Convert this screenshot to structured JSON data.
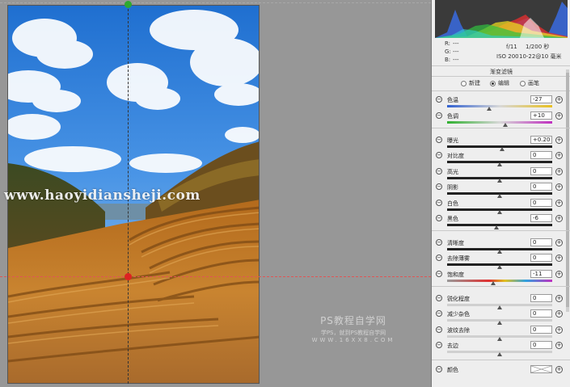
{
  "canvas": {
    "watermark_text": "www.haoyidiansheji.com",
    "logo_watermark": {
      "line1": "PS教程自学网",
      "line2": "学PS，就到PS教程自学网",
      "line3": "WWW.16XX8.COM"
    }
  },
  "info": {
    "r_label": "R:",
    "r_value": "---",
    "g_label": "G:",
    "g_value": "---",
    "b_label": "B:",
    "b_value": "---",
    "aperture": "f/11",
    "shutter": "1/200 秒",
    "iso": "ISO 200",
    "lens": "10-22@10 毫米"
  },
  "panel": {
    "title": "渐变滤镜",
    "modes": [
      {
        "label": "新建",
        "selected": false
      },
      {
        "label": "编辑",
        "selected": true
      },
      {
        "label": "画笔",
        "selected": false
      }
    ],
    "sliders": [
      {
        "label": "色温",
        "value": "-27",
        "position": 0.4,
        "track": "temp"
      },
      {
        "label": "色调",
        "value": "+10",
        "position": 0.55,
        "track": "tint"
      },
      {
        "label": "曝光",
        "value": "+0.20",
        "position": 0.52,
        "track": "gray"
      },
      {
        "label": "对比度",
        "value": "0",
        "position": 0.5,
        "track": "gray"
      },
      {
        "label": "高光",
        "value": "0",
        "position": 0.5,
        "track": "gray"
      },
      {
        "label": "阴影",
        "value": "0",
        "position": 0.5,
        "track": "gray"
      },
      {
        "label": "白色",
        "value": "0",
        "position": 0.5,
        "track": "gray"
      },
      {
        "label": "黑色",
        "value": "-6",
        "position": 0.47,
        "track": "gray"
      },
      {
        "label": "清晰度",
        "value": "0",
        "position": 0.5,
        "track": "gray"
      },
      {
        "label": "去除薄雾",
        "value": "0",
        "position": 0.5,
        "track": "gray"
      },
      {
        "label": "饱和度",
        "value": "-11",
        "position": 0.44,
        "track": "sat"
      },
      {
        "label": "锐化程度",
        "value": "0",
        "position": 0.5,
        "track": "light"
      },
      {
        "label": "减少杂色",
        "value": "0",
        "position": 0.5,
        "track": "light"
      },
      {
        "label": "波纹去除",
        "value": "0",
        "position": 0.5,
        "track": "light"
      },
      {
        "label": "去边",
        "value": "0",
        "position": 0.5,
        "track": "light"
      }
    ],
    "color_label": "颜色"
  },
  "colors": {
    "canvas_bg": "#979797",
    "panel_bg": "#eeeeee",
    "guide_red": "#e05555",
    "pin_green": "#2eaa2e",
    "pin_red": "#dd2222"
  },
  "icons": {
    "minus": "minus-circle-icon",
    "plus": "plus-circle-icon"
  }
}
